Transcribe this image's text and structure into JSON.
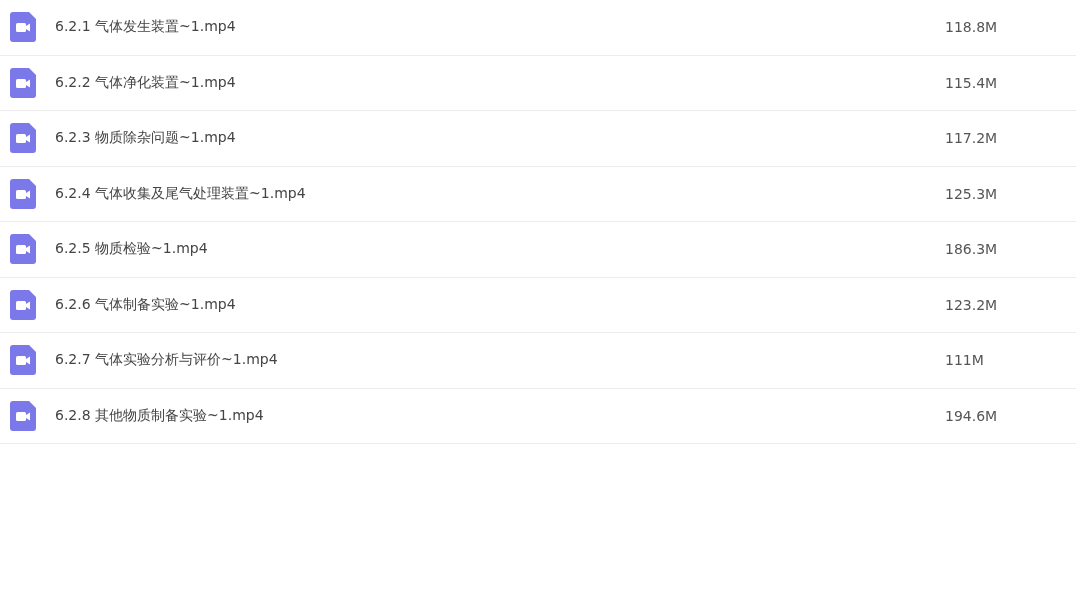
{
  "files": [
    {
      "name": "6.2.1 气体发生装置~1.mp4",
      "size": "118.8M"
    },
    {
      "name": "6.2.2 气体净化装置~1.mp4",
      "size": "115.4M"
    },
    {
      "name": "6.2.3 物质除杂问题~1.mp4",
      "size": "117.2M"
    },
    {
      "name": "6.2.4 气体收集及尾气处理装置~1.mp4",
      "size": "125.3M"
    },
    {
      "name": "6.2.5 物质检验~1.mp4",
      "size": "186.3M"
    },
    {
      "name": "6.2.6 气体制备实验~1.mp4",
      "size": "123.2M"
    },
    {
      "name": "6.2.7 气体实验分析与评价~1.mp4",
      "size": "111M"
    },
    {
      "name": "6.2.8 其他物质制备实验~1.mp4",
      "size": "194.6M"
    }
  ]
}
